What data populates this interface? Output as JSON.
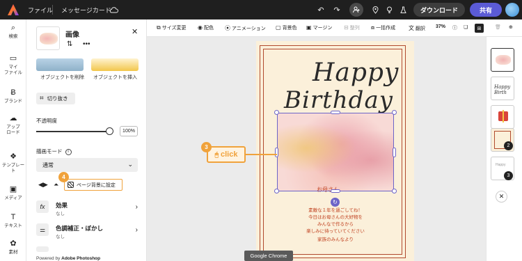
{
  "topbar": {
    "menu_file": "ファイル",
    "doc_title": "メッセージカード",
    "download_label": "ダウンロード",
    "share_label": "共有",
    "icons": [
      "adobe-express-logo",
      "cloud-sync-icon",
      "undo-icon",
      "redo-icon",
      "add-user-icon",
      "location-pin-icon",
      "lightbulb-icon",
      "flask-icon",
      "avatar"
    ]
  },
  "rail": {
    "items": [
      {
        "label": "検索",
        "icon": "search-icon"
      },
      {
        "label": "マイ\nファイル",
        "icon": "folder-icon"
      },
      {
        "label": "ブランド",
        "icon": "brand-icon"
      },
      {
        "label": "アップ\nロード",
        "icon": "upload-icon"
      },
      {
        "label": "テンプレート",
        "icon": "template-icon"
      },
      {
        "label": "メディア",
        "icon": "media-icon"
      },
      {
        "label": "テキスト",
        "icon": "text-icon"
      },
      {
        "label": "素材",
        "icon": "elements-icon"
      }
    ]
  },
  "panel": {
    "title": "画像",
    "remove_object": "オブジェクトを削除",
    "insert_object": "オブジェクトを挿入",
    "crop": "切り抜き",
    "opacity_label": "不透明度",
    "opacity_value": "100%",
    "opacity_level": 1.0,
    "blend_mode_label": "描画モード",
    "blend_mode_value": "通常",
    "set_page_bg": "ページ背景に設定",
    "step4": "4",
    "effects_title": "効果",
    "effects_sub": "なし",
    "adjust_title": "色調補正・ぼかし",
    "adjust_sub": "なし",
    "powered_prefix": "Powered by",
    "powered_brand": "Adobe Photoshop"
  },
  "toolbar": {
    "resize": "サイズ変更",
    "color": "配色",
    "animation": "アニメーション",
    "background": "背景色",
    "margin": "マージン",
    "align": "整列",
    "bulk_create": "一括作成",
    "translate": "翻訳",
    "zoom": "37%"
  },
  "canvas": {
    "happy": "Happy",
    "birthday": "Birthday",
    "covered_text": "お母さん",
    "message_lines": [
      "素敵な１年を過ごしてね！",
      "今日はお母さんの大好物を",
      "みんなで作るから",
      "楽しみに待っていてください",
      "家族のみんなより"
    ],
    "click_callout": "click",
    "step3": "3",
    "tooltip": "Google Chrome"
  },
  "pages": {
    "badges": [
      "2",
      "3"
    ]
  }
}
